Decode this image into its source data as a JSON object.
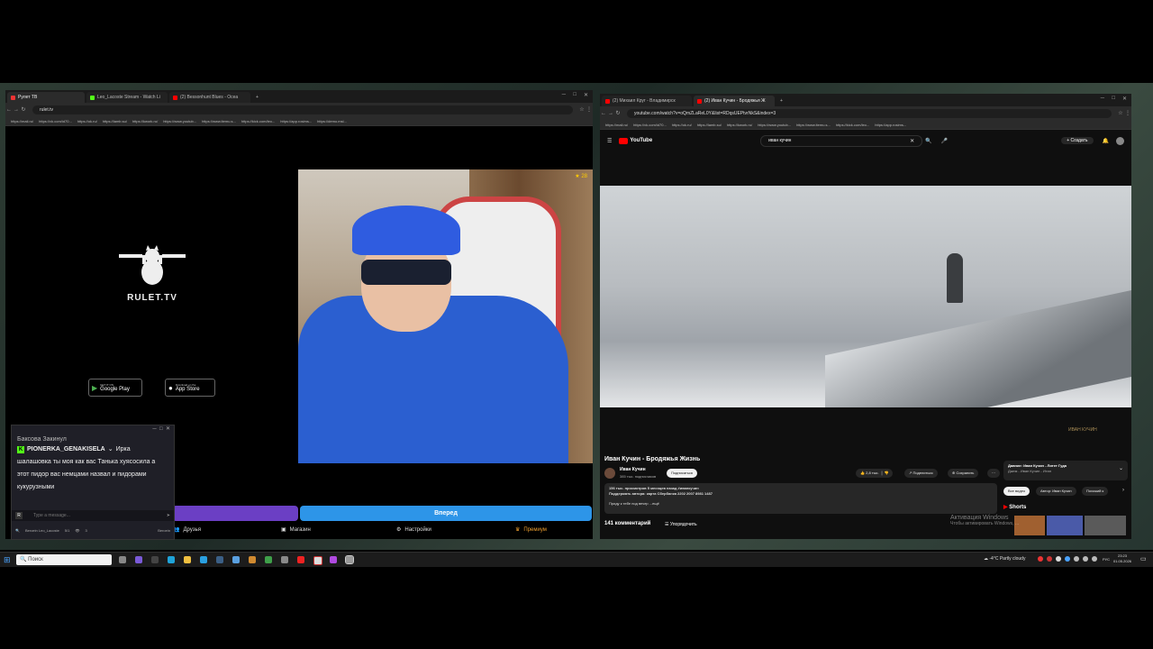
{
  "left_browser": {
    "tabs": [
      {
        "title": "Рулет ТВ",
        "active": true
      },
      {
        "title": "Leo_Lacoste Stream - Watch Li",
        "active": false
      },
      {
        "title": "(2) Bessonhunt Blues - Ocea",
        "active": false
      }
    ],
    "url": "rulet.tv",
    "bookmarks": [
      "https://mail.ru/",
      "https://vk.com/id70...",
      "https://ok.ru/",
      "https://lamb.su/",
      "https://kwork.ru/",
      "https://www.youtub...",
      "https://www.itemu.s...",
      "https://kick.com/leo...",
      "https://app.rosims...",
      "https://demo.msl..."
    ],
    "site": {
      "logo_text": "RULET.TV",
      "google_play_small": "GET IT ON",
      "google_play": "Google Play",
      "app_store_small": "Download on the",
      "app_store": "App Store",
      "cam_badge": "28",
      "next_button": "Вперед",
      "menu": [
        {
          "label": "Друзья",
          "icon": "users-icon"
        },
        {
          "label": "Магазин",
          "icon": "shop-icon"
        },
        {
          "label": "Настройки",
          "icon": "gear-icon"
        },
        {
          "label": "Премиум",
          "icon": "crown-icon"
        }
      ]
    },
    "chat": {
      "top_fragment": "Бакcова Закинул",
      "username": "PIONERKA_GENAKISELA",
      "name_suffix": "Ирка",
      "messages": [
        "шалашовка ты моя как вас Танька хуясосила а",
        "этот пидор вас немцами назвал и пидорами",
        "кукурузными"
      ],
      "input_placeholder": "Type a message...",
      "footer_channel": "Beroein Leo_Lacoste",
      "footer_count": "5/1",
      "footer_viewers": "3",
      "footer_extra": "Beroein"
    }
  },
  "right_browser": {
    "tabs": [
      {
        "title": "(2) Михаил Круг - Владимирск",
        "active": false
      },
      {
        "title": "(2) Иван Кучин - Бродяжья Ж",
        "active": true
      }
    ],
    "url": "youtube.com/watch?v=oQmZLaReL0Y&list=RDqsUEPtvrNkS&index=3",
    "bookmarks": [
      "https://mail.ru/",
      "https://vk.com/id70...",
      "https://ok.ru/",
      "https://lamb.su/",
      "https://kwork.ru/",
      "https://www.youtub...",
      "https://www.itemu.s...",
      "https://kick.com/leo...",
      "https://app.rosims..."
    ],
    "youtube": {
      "logo": "YouTube",
      "search_query": "иван кучин",
      "create_label": "Создать",
      "watermark": "ИВАН КУЧИН",
      "video_title": "Иван Кучин - Бродяжья Жизнь",
      "channel_name": "Иван Кучин",
      "subscribers": "385 тыс. подписчиков",
      "subscribe_label": "Подписаться",
      "likes": "2,8 тыс.",
      "share_label": "Поделиться",
      "save_label": "Сохранить",
      "views_line": "156 тыс. просмотров  5 месяцев назад  #иванкучин",
      "desc_line1": "Поддержать автора: карта Сбербанка 2202 2007 8981 1487",
      "desc_line2": "Приду к тебе под вечер ...ещё",
      "comments_count": "141 комментарий",
      "sort_label": "Упорядочить",
      "mix_title": "Давние: Иван Кучин - Литет Гуда",
      "mix_subtitle": "Джем - Иван Кучин - Итан",
      "chips": [
        "Все видео",
        "Автор: Иван Кучин",
        "Похожий к"
      ],
      "shorts_label": "Shorts",
      "activation_title": "Активация Windows",
      "activation_sub": "Чтобы активировать Windows, ..."
    }
  },
  "taskbar": {
    "search_placeholder": "Поиск",
    "weather": "-4°C  Partly cloudy",
    "lang": "РУС",
    "time": "23:23",
    "date": "01.05.2026"
  }
}
